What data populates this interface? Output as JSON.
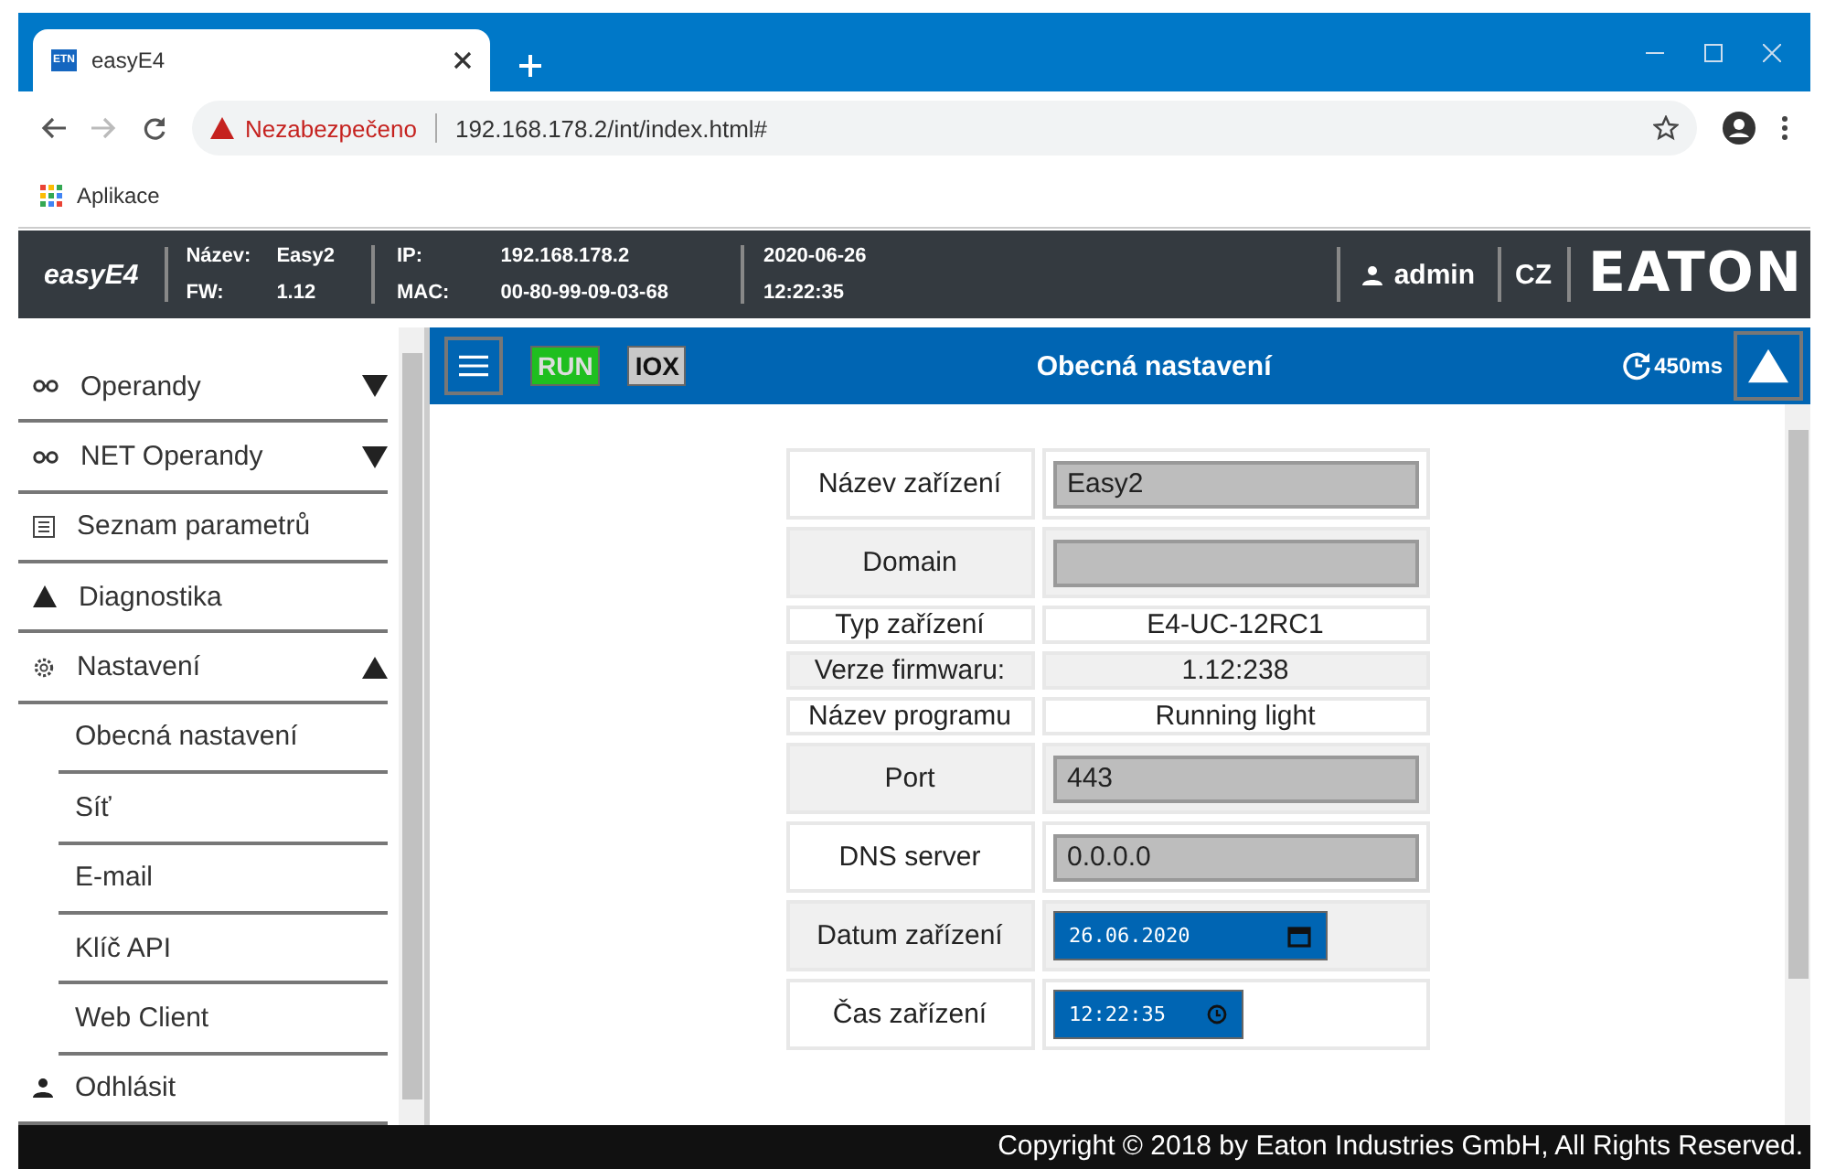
{
  "browser": {
    "tab_title": "easyE4",
    "tab_favicon": "ETN",
    "security_label": "Nezabezpečeno",
    "url": "192.168.178.2/int/index.html#",
    "bookmarks": [
      {
        "label": "Aplikace"
      }
    ]
  },
  "header": {
    "brand": "easyE4",
    "info": [
      {
        "label": "Název:",
        "value": "Easy2"
      },
      {
        "label": "FW:",
        "value": "1.12"
      },
      {
        "label": "IP:",
        "value": "192.168.178.2"
      },
      {
        "label": "MAC:",
        "value": "00-80-99-09-03-68"
      }
    ],
    "date": "2020-06-26",
    "time": "12:22:35",
    "user": "admin",
    "language": "CZ",
    "logo": "EATON"
  },
  "sidebar": {
    "items": [
      {
        "label": "Operandy",
        "kind": "glasses",
        "expanded": false
      },
      {
        "label": "NET Operandy",
        "kind": "glasses",
        "expanded": false
      },
      {
        "label": "Seznam parametrů",
        "kind": "list"
      },
      {
        "label": "Diagnostika",
        "kind": "warning"
      },
      {
        "label": "Nastavení",
        "kind": "gear",
        "expanded": true,
        "children": [
          {
            "label": "Obecná nastavení"
          },
          {
            "label": "Síť"
          },
          {
            "label": "E-mail"
          },
          {
            "label": "Klíč API"
          },
          {
            "label": "Web Client"
          }
        ]
      },
      {
        "label": "Odhlásit",
        "kind": "person"
      }
    ]
  },
  "toolbar": {
    "status_buttons": [
      {
        "label": "RUN",
        "color": "#1fbf1f"
      },
      {
        "label": "IOX",
        "color": "#c8c8c8"
      }
    ],
    "title": "Obecná nastavení",
    "cycle_time": "450ms"
  },
  "settings": [
    {
      "label": "Název zařízení",
      "kind": "input",
      "value": "Easy2"
    },
    {
      "label": "Domain",
      "kind": "input"
    },
    {
      "label": "Typ zařízení",
      "kind": "text",
      "value": "E4-UC-12RC1"
    },
    {
      "label": "Verze firmwaru:",
      "kind": "text",
      "value": "1.12:238"
    },
    {
      "label": "Název programu",
      "kind": "text",
      "value": "Running light"
    },
    {
      "label": "Port",
      "kind": "input",
      "value": "443"
    },
    {
      "label": "DNS server",
      "kind": "input",
      "value": "0.0.0.0"
    },
    {
      "label": "Datum zařízení",
      "kind": "date",
      "value": "26.06.2020"
    },
    {
      "label": "Čas zařízení",
      "kind": "time",
      "value": "12:22:35"
    }
  ],
  "footer": "Copyright © 2018 by Eaton Industries GmbH, All Rights Reserved."
}
